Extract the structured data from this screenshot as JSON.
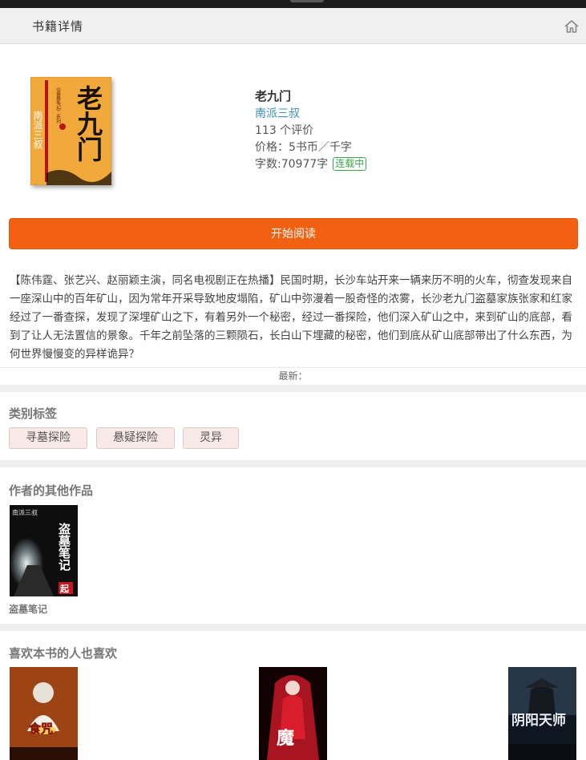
{
  "header": {
    "title": "书籍详情",
    "home_icon": "home-icon"
  },
  "book": {
    "title": "老九门",
    "author": "南派三叔",
    "reviews": "113 个评价",
    "price": "价格：5书币／千字",
    "word_count": "字数:70977字",
    "status_badge": "连载中",
    "cover": {
      "big_title": "老九门",
      "author_on_cover": "南派三叔",
      "series_mark": "《盗墓笔记》系列",
      "colors": {
        "background": "#f2a93b",
        "title": "#1a1208",
        "band": "#b8141c"
      }
    }
  },
  "read_button": {
    "label": "开始阅读",
    "color": "#f26112"
  },
  "description": "【陈伟霆、张艺兴、赵丽颖主演，同名电视剧正在热播】民国时期，长沙车站开来一辆来历不明的火车，彻查发现来自一座深山中的百年矿山，因为常年开采导致地皮塌陷，矿山中弥漫着一股奇怪的浓雾，长沙老九门盗墓家族张家和红家经过了一番查探，发现了深埋矿山之下，有着另外一个秘密，经过一番探险，他们深入矿山之中，来到矿山的底部，看到了让人无法置信的景象。千年之前坠落的三颗陨石，长白山下埋藏的秘密，他们到底从矿山底部带出了什么东西，为何世界慢慢变的异样诡异？",
  "latest": {
    "label": "最新："
  },
  "tags": {
    "title": "类别标签",
    "items": [
      "寻墓探险",
      "悬疑探险",
      "灵异"
    ]
  },
  "other_works": {
    "title": "作者的其他作品",
    "items": [
      {
        "name": "盗墓笔记",
        "cover_author": "南派三叔",
        "cover_title": "盗墓笔记",
        "cover_mark": "起"
      }
    ]
  },
  "also_like": {
    "title": "喜欢本书的人也喜欢",
    "items": [
      {
        "cover_title": "食咒"
      },
      {
        "cover_title": "魔"
      },
      {
        "cover_title": "阴阳天师"
      }
    ]
  }
}
